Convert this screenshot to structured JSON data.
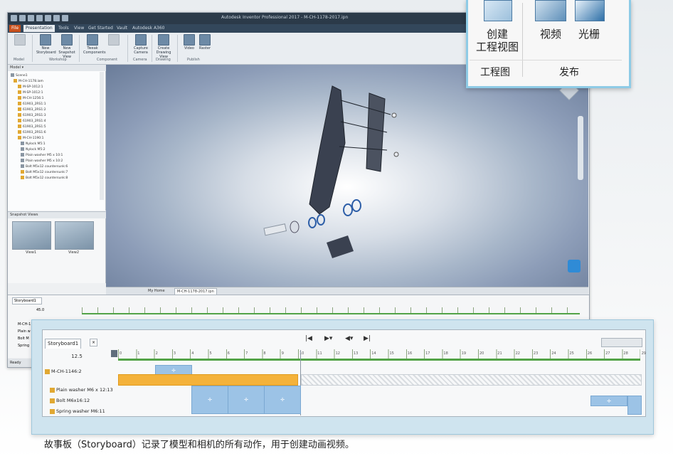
{
  "app": {
    "title": "Autodesk Inventor Professional 2017 - M-CH-1178-2017.ipn",
    "ribbon_tabs": [
      "File",
      "Presentation",
      "Tools",
      "View",
      "Get Started",
      "Vault",
      "Autodesk A360"
    ],
    "ribbon_buttons": [
      {
        "label": "New Storyboard",
        "group": "Workshop"
      },
      {
        "label": "New Snapshot View",
        "group": "Workshop"
      },
      {
        "label": "Tweak Components",
        "group": "Component"
      },
      {
        "label": "Capture Camera",
        "group": "Camera"
      },
      {
        "label": "Create Drawing View",
        "group": "Drawing"
      },
      {
        "label": "Video",
        "group": "Publish"
      },
      {
        "label": "Raster",
        "group": "Publish"
      }
    ],
    "ribbon_groups": [
      "Model",
      "Workshop",
      "Component",
      "Camera",
      "Drawing",
      "Publish"
    ],
    "browser": {
      "header": "Model ▾",
      "items": [
        "Scene1",
        "M-CH-1178.iam",
        "M-SP-1012:1",
        "M-SP-1012:1",
        "M-CH-1256:1",
        "61903_2RS1:1",
        "61903_2RS1:2",
        "61903_2RS1:3",
        "61903_2RS1:4",
        "61903_2RS1:5",
        "61903_2RS1:6",
        "M-CH-1190:1",
        "Nylock M5:1",
        "Nylock M5:2",
        "Plain washer M5 x 10:1",
        "Plain washer M5 x 10:2",
        "Bolt M5x12 countersunk:6",
        "Bolt M5x12 countersunk:7",
        "Bolt M5x12 countersunk:8"
      ]
    },
    "snapshot_pane": {
      "header": "Snapshot Views",
      "views": [
        "View1",
        "View2"
      ]
    },
    "viewport_tabs": [
      "My Home",
      "M-CH-1178-2017.ipn"
    ],
    "storyboard_small": {
      "tab": "Storyboard1",
      "time": "45.0",
      "rows": [
        "M-CH-1146:2",
        "Plain w",
        "Bolt M",
        "Spring"
      ]
    },
    "status": "Ready"
  },
  "zoom_ribbon": {
    "buttons": [
      {
        "label_line1": "创建",
        "label_line2": "工程视图"
      },
      {
        "label": "视频"
      },
      {
        "label": "光栅"
      }
    ],
    "groups": [
      "工程图",
      "发布"
    ]
  },
  "zoom_storyboard": {
    "tab": "Storyboard1",
    "time": "12.5",
    "controls": [
      "|◀",
      "▶▾",
      "◀▾",
      "▶|"
    ],
    "ticks": [
      "0",
      "1",
      "2",
      "3",
      "4",
      "5",
      "6",
      "7",
      "8",
      "9",
      "10",
      "11",
      "12",
      "13",
      "14",
      "15",
      "16",
      "17",
      "18",
      "19",
      "20",
      "21",
      "22",
      "23",
      "24",
      "25",
      "26",
      "27",
      "28",
      "29"
    ],
    "rows": [
      "M-CH-1146:2",
      "Plain washer M6 x 12:13",
      "Bolt M6x16:12",
      "Spring washer M6:11"
    ]
  },
  "caption": "故事板（Storyboard）记录了模型和相机的所有动作，用于创建动画视频。",
  "colors": {
    "accent": "#8ecbe6",
    "timeline_green": "#53a347",
    "bar_blue": "#9cc3e6",
    "bar_orange": "#f4b23a"
  }
}
